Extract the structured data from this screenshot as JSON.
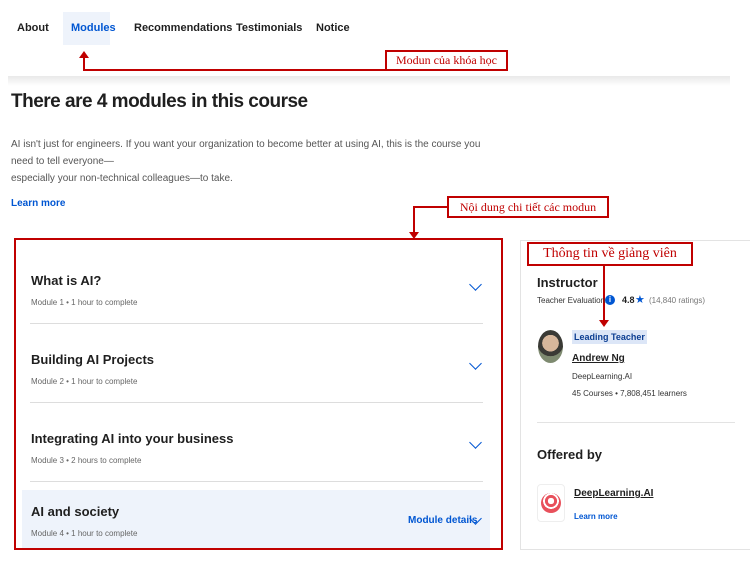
{
  "nav": {
    "tabs": [
      {
        "label": "About",
        "active": false
      },
      {
        "label": "Modules",
        "active": true
      },
      {
        "label": "Recommendations",
        "active": false
      },
      {
        "label": "Testimonials",
        "active": false
      },
      {
        "label": "Notice",
        "active": false
      }
    ]
  },
  "annotations": {
    "modules": "Modun của khóa học",
    "module_details": "Nội dung chi tiết các modun",
    "instructor": "Thông tin về giảng viên"
  },
  "main": {
    "title": "There are 4 modules in this course",
    "description_1": "AI isn't just for engineers. If you want your organization to become better at using AI, this is the course you need to tell everyone—",
    "description_2": "especially your non-technical colleagues—to take.",
    "learn_more": "Learn more",
    "modules": [
      {
        "title": "What is AI?",
        "meta": "Module 1 • 1 hour to complete"
      },
      {
        "title": "Building AI Projects",
        "meta": "Module 2 • 1 hour to complete"
      },
      {
        "title": "Integrating AI into your business",
        "meta": "Module 3 • 2 hours to complete"
      },
      {
        "title": "AI and society",
        "meta": "Module 4 • 1 hour to complete"
      }
    ],
    "module_details_label": "Module details"
  },
  "sidebar": {
    "instructor_heading": "Instructor",
    "evaluations_label": "Teacher Evaluations",
    "rating": "4.8",
    "ratings_count": "(14,840 ratings)",
    "badge": "Leading Teacher",
    "instructor_name": "Andrew Ng",
    "instructor_org": "DeepLearning.AI",
    "instructor_stats": "45 Courses • 7,808,451 learners",
    "offered_by_heading": "Offered by",
    "offered_by_name": "DeepLearning.AI",
    "offered_by_link": "Learn more"
  },
  "colors": {
    "accent": "#0056d2",
    "annotation": "#c00000",
    "logo": "#e8505b"
  }
}
